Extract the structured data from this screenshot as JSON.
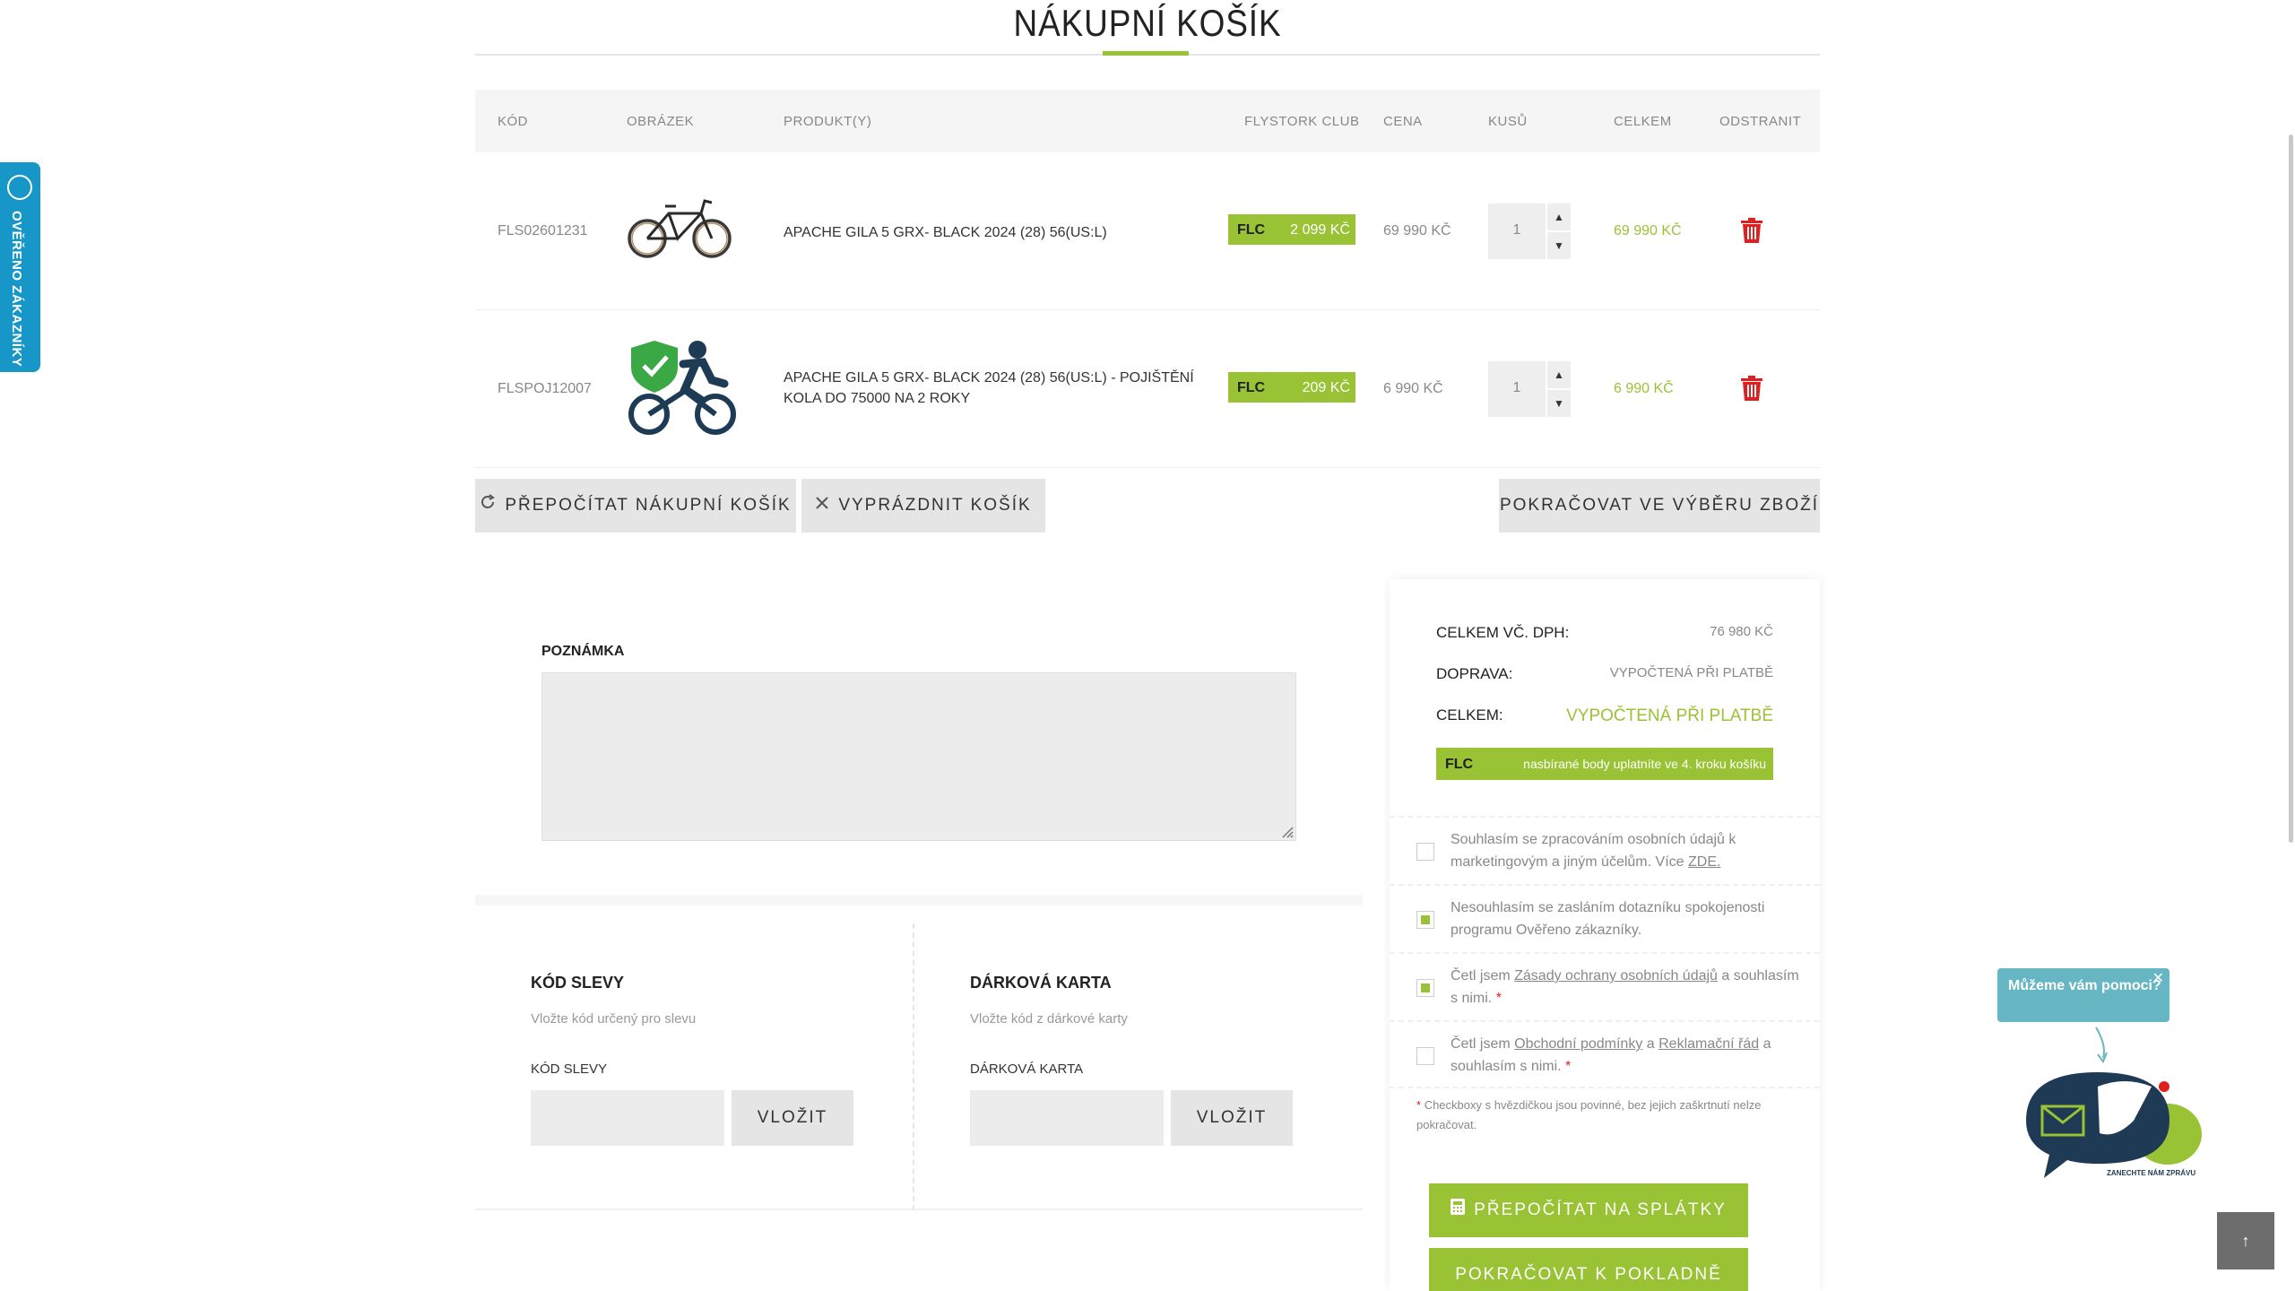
{
  "page": {
    "title": "NÁKUPNÍ KOŠÍK"
  },
  "colors": {
    "accent": "#99c234",
    "widget_blue": "#1797c8",
    "help_bubble": "#67b6c4",
    "danger": "#e02020"
  },
  "side_widget": {
    "label": "OVĚŘENO ZÁKAZNÍKY",
    "icon": "heureka-logo-icon"
  },
  "cart": {
    "headers": {
      "code": "KÓD",
      "image": "OBRÁZEK",
      "product": "PRODUKT(Y)",
      "club": "FLYSTORK CLUB",
      "price": "CENA",
      "qty": "KUSŮ",
      "total": "CELKEM",
      "remove": "ODSTRANIT"
    },
    "rows": [
      {
        "code": "FLS02601231",
        "image_icon": "bicycle-image",
        "name": "APACHE GILA 5 GRX- BLACK 2024 (28) 56(US:L)",
        "flc_label": "FLC",
        "flc_points": "2 099 KČ",
        "price": "69 990 KČ",
        "qty": "1",
        "total": "69 990 KČ"
      },
      {
        "code": "FLSPOJ12007",
        "image_icon": "insurance-cyclist-image",
        "name": "APACHE GILA 5 GRX- BLACK 2024 (28) 56(US:L) - POJIŠTĚNÍ KOLA DO 75000 NA 2 ROKY",
        "flc_label": "FLC",
        "flc_points": "209 KČ",
        "price": "6 990 KČ",
        "qty": "1",
        "total": "6 990 KČ"
      }
    ]
  },
  "actions": {
    "recalc": "PŘEPOČÍTAT NÁKUPNÍ KOŠÍK",
    "empty": "VYPRÁZDNIT KOŠÍK",
    "continue": "POKRAČOVAT VE VÝBĚRU ZBOŽÍ"
  },
  "note": {
    "label": "POZNÁMKA",
    "value": ""
  },
  "discount": {
    "title": "KÓD SLEVY",
    "subtitle": "Vložte kód určený pro slevu",
    "field_label": "KÓD SLEVY",
    "value": "",
    "button": "VLOŽIT"
  },
  "gift": {
    "title": "DÁRKOVÁ KARTA",
    "subtitle": "Vložte kód z dárkové karty",
    "field_label": "DÁRKOVÁ KARTA",
    "value": "",
    "button": "VLOŽIT"
  },
  "summary": {
    "total_vat_label": "CELKEM VČ. DPH:",
    "total_vat_value": "76 980 KČ",
    "shipping_label": "DOPRAVA:",
    "shipping_value": "VYPOČTENÁ PŘI PLATBĚ",
    "total_label": "CELKEM:",
    "total_value": "VYPOČTENÁ PŘI PLATBĚ",
    "flc_label": "FLC",
    "flc_text": "nasbírané body uplatníte ve 4. kroku košíku"
  },
  "consents": [
    {
      "checked": false,
      "text_pre": "Souhlasím se zpracováním osobních údajů k marketingovým a jiným účelům. Více ",
      "link": "ZDE.",
      "text_post": ""
    },
    {
      "checked": true,
      "text_pre": "Nesouhlasím se zasláním dotazníku spokojenosti programu Ověřeno zákazníky.",
      "link": "",
      "text_post": ""
    },
    {
      "checked": true,
      "text_pre": "Četl jsem ",
      "link": "Zásady ochrany osobních údajů",
      "text_post": " a souhlasím s nimi.",
      "required": "*"
    },
    {
      "checked": false,
      "text_pre": "Četl jsem ",
      "link": "Obchodní podmínky",
      "text_mid": " a ",
      "link2": "Reklamační řád",
      "text_post": " a souhlasím s nimi.",
      "required": "*"
    }
  ],
  "footnote": {
    "star": "*",
    "text": "Checkboxy s hvězdičkou jsou povinné, bez jejich zaškrtnutí nelze pokračovat."
  },
  "buttons": {
    "installments": "PŘEPOČÍTAT NA SPLÁTKY",
    "checkout": "POKRAČOVAT K POKLADNĚ"
  },
  "help": {
    "bubble": "Můžeme vám pomoci?",
    "close": "✕",
    "badge_text": "ZANECHTE NÁM ZPRÁVU"
  },
  "to_top": "↑"
}
